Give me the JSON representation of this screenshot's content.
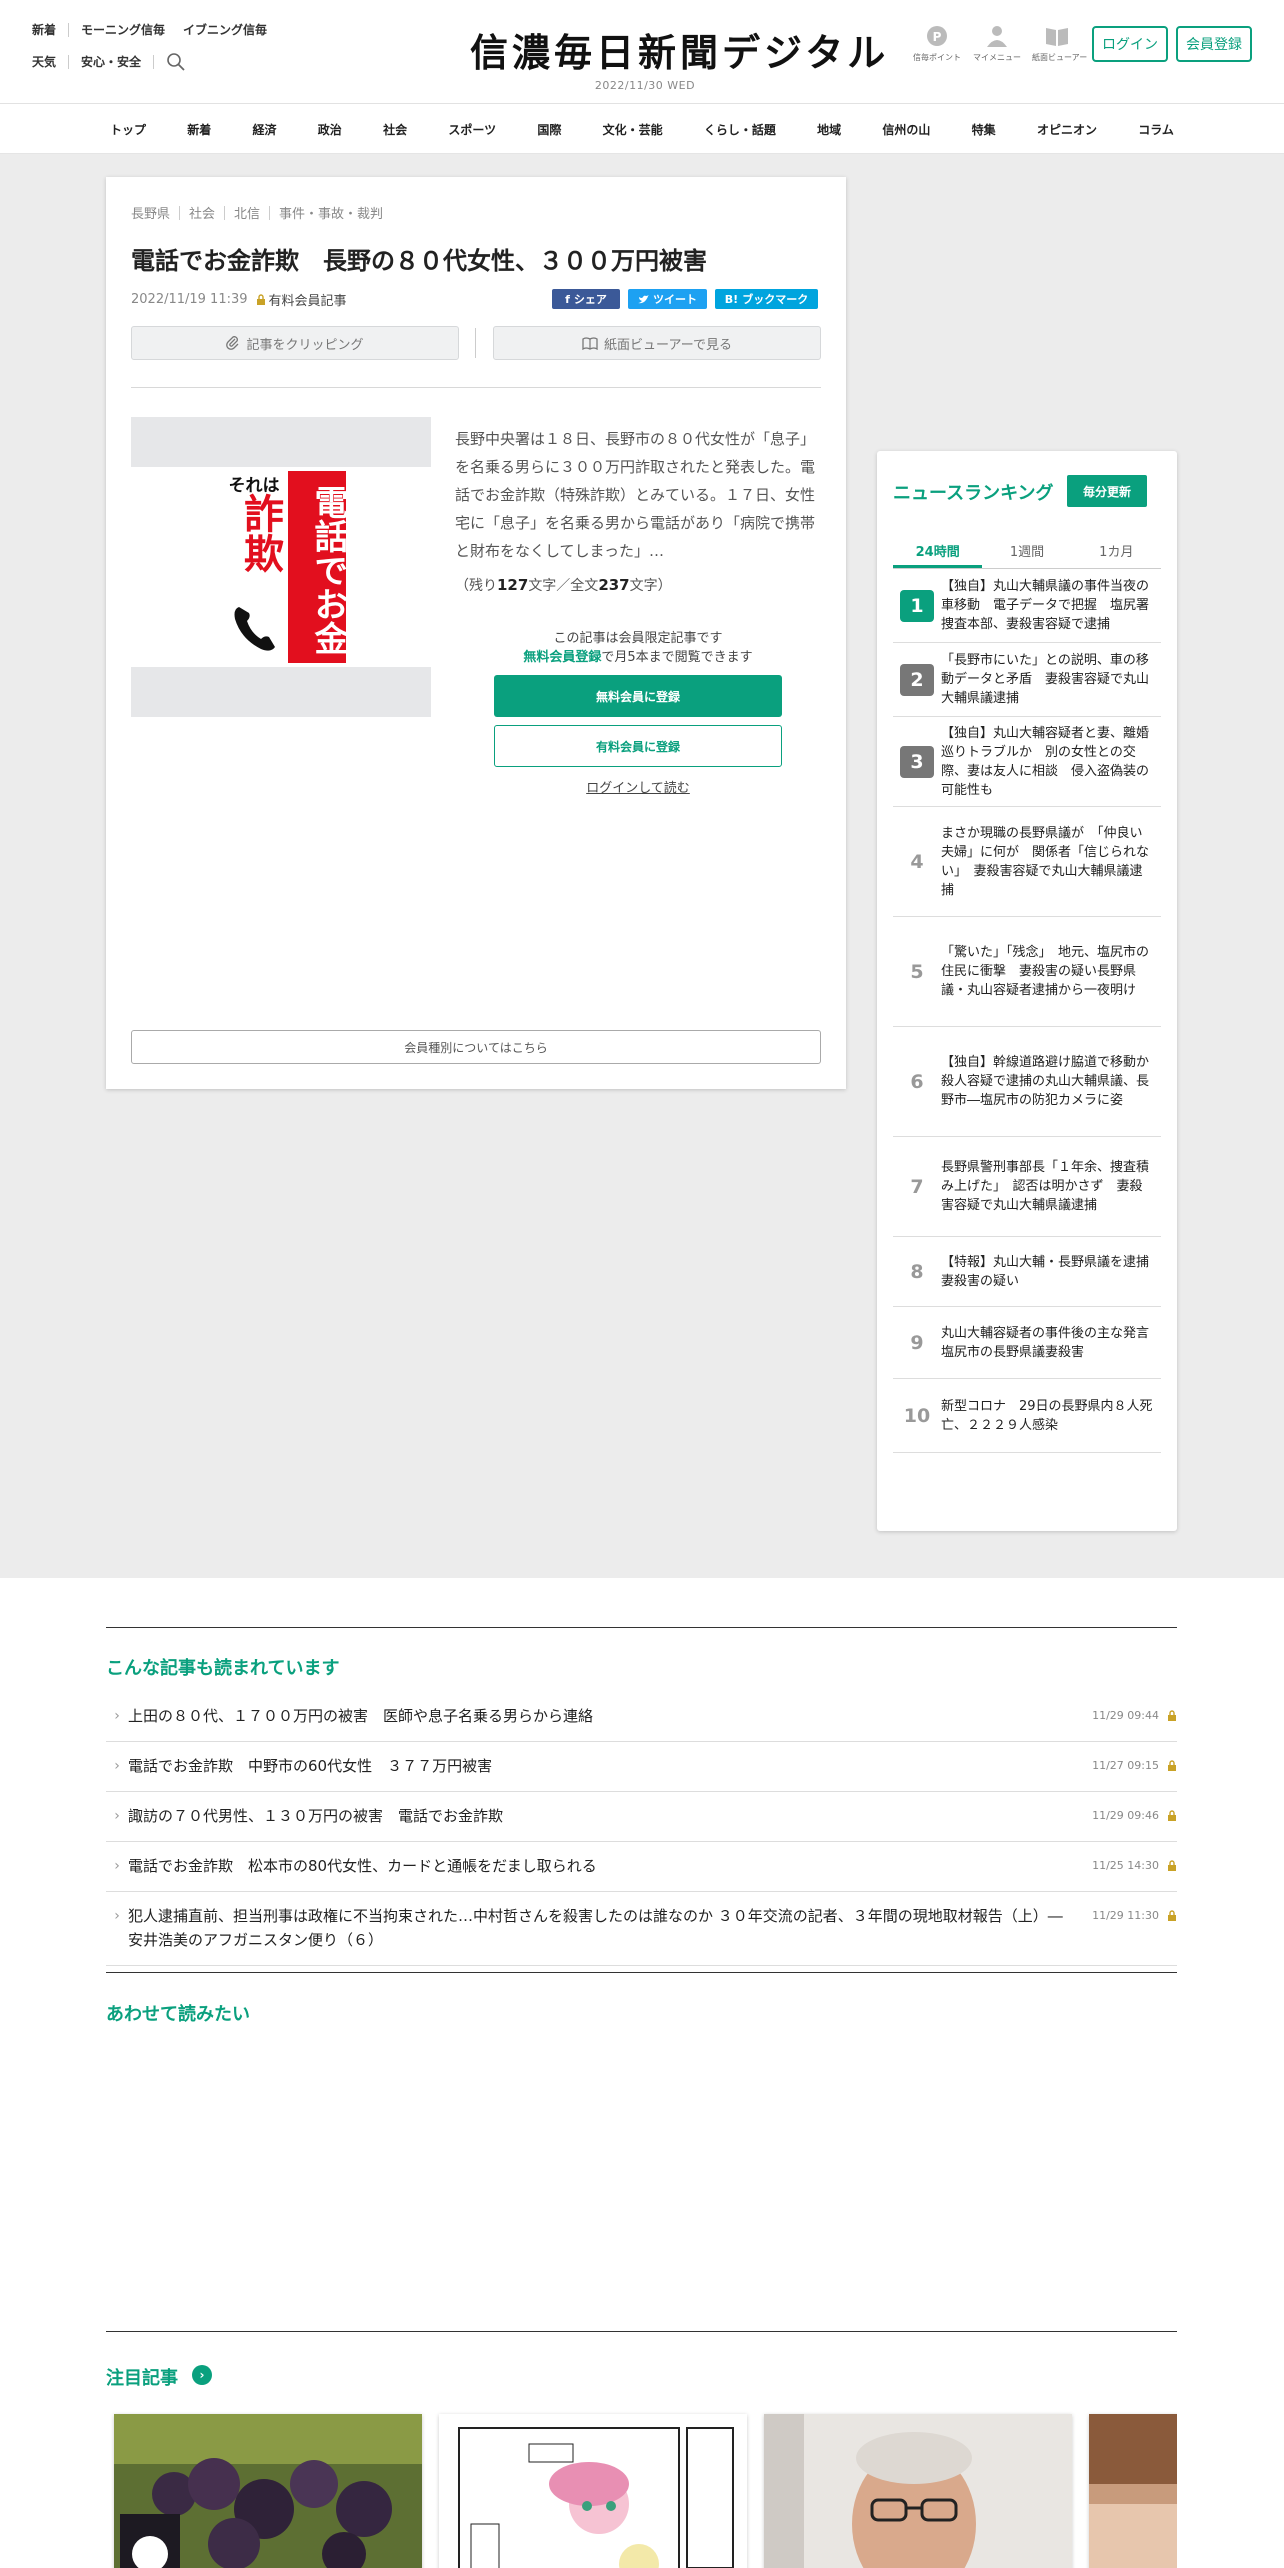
{
  "header": {
    "links_row1": [
      "新着",
      "モーニング信毎",
      "イブニング信毎"
    ],
    "links_row2": [
      "天気",
      "安心・安全"
    ],
    "logo": "信濃毎日新聞デジタル",
    "date": "2022/11/30",
    "weekday": "WED",
    "icons": [
      {
        "icon": "points-icon",
        "label": "信毎ポイント"
      },
      {
        "icon": "user-icon",
        "label": "マイメニュー"
      },
      {
        "icon": "newspaper-icon",
        "label": "紙面ビューアー"
      }
    ],
    "login": "ログイン",
    "register": "会員登録"
  },
  "nav": [
    "トップ",
    "新着",
    "経済",
    "政治",
    "社会",
    "スポーツ",
    "国際",
    "文化・芸能",
    "くらし・話題",
    "地域",
    "信州の山",
    "特集",
    "オピニオン",
    "コラム"
  ],
  "article": {
    "crumbs": [
      "長野県",
      "社会",
      "北信",
      "事件・事故・裁判"
    ],
    "title": "電話でお金詐欺　長野の８０代女性、３００万円被害",
    "datetime": "2022/11/19 11:39",
    "member_type": "有料会員記事",
    "share": {
      "facebook": "シェア",
      "twitter": "ツイート",
      "hatena": "ブックマーク",
      "hatena_mark": "B!"
    },
    "clip": "記事をクリッピング",
    "viewer": "紙面ビューアーで見る",
    "photo": {
      "small": "それは",
      "big": "詐欺",
      "red": "電話でお金"
    },
    "lead": "長野中央署は１８日、長野市の８０代女性が「息子」を名乗る男らに３００万円詐取されたと発表した。電話でお金詐欺（特殊詐欺）とみている。１７日、女性宅に「息子」を名乗る男から電話があり「病院で携帯と財布をなくしてしまった」…",
    "remain_prefix": "（残り",
    "remain_count": "127",
    "remain_mid": "文字／全文",
    "total_count": "237",
    "remain_suffix": "文字）",
    "paywall_line1": "この記事は会員限定記事です",
    "paywall_hl": "無料会員登録",
    "paywall_line2": "で月5本まで閲覧できます",
    "btn_free": "無料会員に登録",
    "btn_paid": "有料会員に登録",
    "login_read": "ログインして読む",
    "member_types": "会員種別についてはこちら"
  },
  "ranking": {
    "title": "ニュースランキング",
    "update": "毎分更新",
    "tabs": [
      "24時間",
      "1週間",
      "1カ月"
    ],
    "active_tab": 0,
    "items": [
      {
        "rank": "1",
        "text": "【独自】丸山大輔県議の事件当夜の車移動　電子データで把握　塩尻署捜査本部、妻殺害容疑で逮捕"
      },
      {
        "rank": "2",
        "text": "「長野市にいた」との説明、車の移動データと矛盾　妻殺害容疑で丸山大輔県議逮捕"
      },
      {
        "rank": "3",
        "text": "【独自】丸山大輔容疑者と妻、離婚巡りトラブルか　別の女性との交際、妻は友人に相談　侵入盗偽装の可能性も"
      },
      {
        "rank": "4",
        "text": "まさか現職の長野県議が　「仲良い夫婦」に何が　関係者「信じられない」　妻殺害容疑で丸山大輔県議逮捕"
      },
      {
        "rank": "5",
        "text": "「驚いた」「残念」　地元、塩尻市の住民に衝撃　妻殺害の疑い長野県議・丸山容疑者逮捕から一夜明け"
      },
      {
        "rank": "6",
        "text": "【独自】幹線道路避け脇道で移動か　殺人容疑で逮捕の丸山大輔県議、長野市―塩尻市の防犯カメラに姿"
      },
      {
        "rank": "7",
        "text": "長野県警刑事部長「１年余、捜査積み上げた」　認否は明かさず　妻殺害容疑で丸山大輔県議逮捕"
      },
      {
        "rank": "8",
        "text": "【特報】丸山大輔・長野県議を逮捕　妻殺害の疑い"
      },
      {
        "rank": "9",
        "text": "丸山大輔容疑者の事件後の主な発言　塩尻市の長野県議妻殺害"
      },
      {
        "rank": "10",
        "text": "新型コロナ　29日の長野県内８人死亡、２２２９人感染"
      }
    ]
  },
  "also_read": {
    "title": "こんな記事も読まれています",
    "items": [
      {
        "title": "上田の８０代、１７００万円の被害　医師や息子名乗る男らから連絡",
        "date": "11/29 09:44"
      },
      {
        "title": "電話でお金詐欺　中野市の60代女性　３７７万円被害",
        "date": "11/27 09:15"
      },
      {
        "title": "諏訪の７０代男性、１３０万円の被害　電話でお金詐欺",
        "date": "11/29 09:46"
      },
      {
        "title": "電話でお金詐欺　松本市の80代女性、カードと通帳をだまし取られる",
        "date": "11/25 14:30"
      },
      {
        "title": "犯人逮捕直前、担当刑事は政権に不当拘束された…中村哲さんを殺害したのは誰なのか ３０年交流の記者、３年間の現地取材報告（上）―安井浩美のアフガニスタン便り（６）",
        "date": "11/29 11:30"
      }
    ]
  },
  "recommend": {
    "title": "あわせて読みたい"
  },
  "featured": {
    "title": "注目記事",
    "cards": [
      {
        "image": "grapes-photo"
      },
      {
        "image": "manga-illustration"
      },
      {
        "image": "man-portrait-photo"
      },
      {
        "image": "partial-photo"
      }
    ]
  },
  "colors": {
    "accent": "#0aa07e",
    "gray_bg": "#ececec"
  }
}
